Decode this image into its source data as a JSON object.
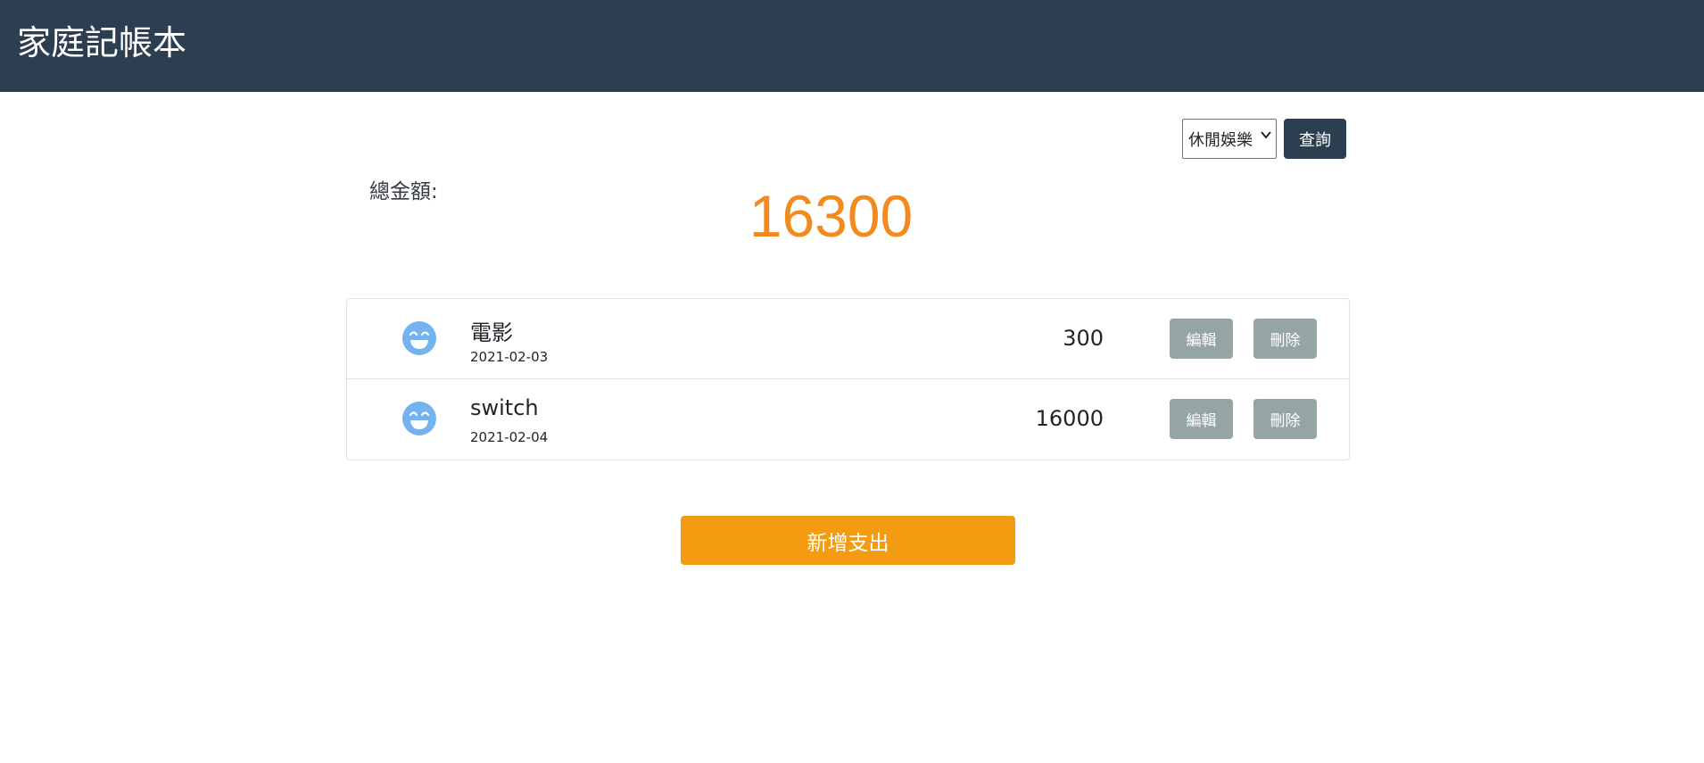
{
  "app": {
    "title": "家庭記帳本"
  },
  "filter": {
    "selected": "休閒娛樂",
    "query_label": "查詢"
  },
  "summary": {
    "label": "總金額:",
    "total": "16300"
  },
  "expenses": [
    {
      "name": "電影",
      "date": "2021-02-03",
      "amount": "300",
      "edit_label": "編輯",
      "delete_label": "刪除",
      "icon": "smile-icon"
    },
    {
      "name": "switch",
      "date": "2021-02-04",
      "amount": "16000",
      "edit_label": "編輯",
      "delete_label": "刪除",
      "icon": "smile-icon"
    }
  ],
  "actions": {
    "add_label": "新增支出"
  },
  "colors": {
    "navbar": "#2c3e50",
    "accent": "#f39c12",
    "total": "#f28a1e",
    "button_gray": "#95a5a6",
    "icon": "#74b3ef"
  }
}
